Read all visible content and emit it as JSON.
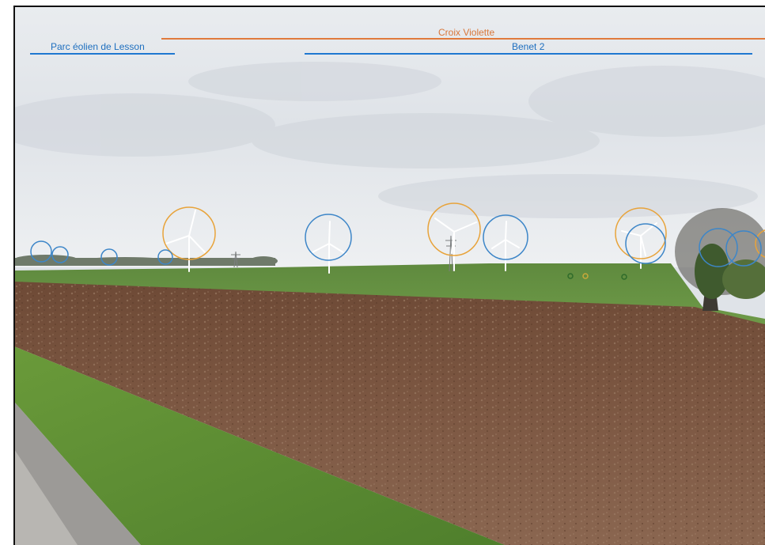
{
  "annotations": {
    "croix_violette": {
      "label": "Croix Violette",
      "color": "#e07a3c"
    },
    "parc_eolien_de_lesson": {
      "label": "Parc éolien de Lesson",
      "color": "#1f78d1"
    },
    "benet_2": {
      "label": "Benet 2",
      "color": "#1f78d1"
    }
  },
  "scene": {
    "content": "Wind farm photomontage: ploughed field, grass verge and road in foreground, wind turbines on horizon marked with circles",
    "circle_colors": {
      "croix_violette": "#e8a33a",
      "benet_2": "#3d86c8"
    }
  }
}
